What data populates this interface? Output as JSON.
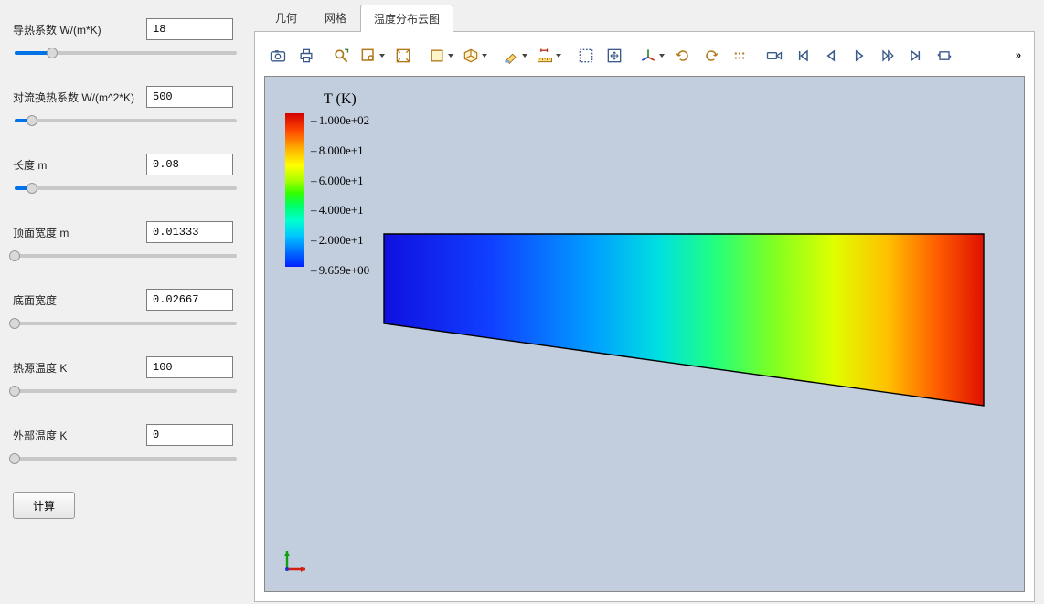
{
  "sidebar": {
    "params": [
      {
        "label": "导热系数 W/(m*K)",
        "value": "18",
        "pos_pct": 17
      },
      {
        "label": "对流换热系数 W/(m^2*K)",
        "value": "500",
        "pos_pct": 8
      },
      {
        "label": "长度 m",
        "value": "0.08",
        "pos_pct": 8
      },
      {
        "label": "顶面宽度 m",
        "value": "0.01333",
        "pos_pct": 0
      },
      {
        "label": "底面宽度",
        "value": "0.02667",
        "pos_pct": 0
      },
      {
        "label": "热源温度 K",
        "value": "100",
        "pos_pct": 0
      },
      {
        "label": "外部温度 K",
        "value": "0",
        "pos_pct": 0
      }
    ],
    "compute_label": "计算"
  },
  "tabs": {
    "items": [
      "几何",
      "网格",
      "温度分布云图"
    ],
    "active_index": 2
  },
  "toolbar": {
    "overflow_glyph": "»"
  },
  "legend": {
    "title": "T (K)",
    "ticks": [
      "1.000e+02",
      "8.000e+1",
      "6.000e+1",
      "4.000e+1",
      "2.000e+1",
      "9.659e+00"
    ]
  }
}
